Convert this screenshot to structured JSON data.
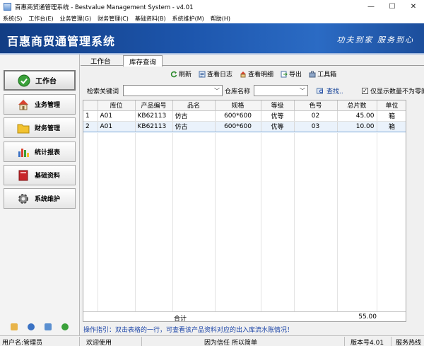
{
  "window": {
    "title": "百惠商贸通管理系统 - Bestvalue Management System - v4.01",
    "controls": [
      "—",
      "☐",
      "✕"
    ]
  },
  "menu": [
    "系统(S)",
    "工作台(E)",
    "业务管理(G)",
    "财务管理(C)",
    "基础资料(B)",
    "系统维护(M)",
    "帮助(H)"
  ],
  "banner": {
    "title": "百惠商贸通管理系统",
    "slogan": "功夫到家 服务到心"
  },
  "sidebar": {
    "items": [
      {
        "label": "工作台",
        "icon": "check-circle-icon",
        "active": true
      },
      {
        "label": "业务管理",
        "icon": "house-icon",
        "active": false
      },
      {
        "label": "财务管理",
        "icon": "folder-icon",
        "active": false
      },
      {
        "label": "统计报表",
        "icon": "bar-chart-icon",
        "active": false
      },
      {
        "label": "基础资料",
        "icon": "book-icon",
        "active": false
      },
      {
        "label": "系统维护",
        "icon": "gear-icon",
        "active": false
      }
    ],
    "footer_icons": [
      "edit-icon",
      "info-icon",
      "search-icon",
      "refresh-icon"
    ]
  },
  "tabs": [
    {
      "label": "工作台",
      "active": false
    },
    {
      "label": "库存查询",
      "active": true
    }
  ],
  "toolbar": {
    "refresh": "刷新",
    "view_log": "查看日志",
    "view_detail": "查看明细",
    "export": "导出",
    "toolbox": "工具箱"
  },
  "filters": {
    "keyword_label": "检索关键词",
    "keyword_value": "",
    "warehouse_label": "仓库名称",
    "warehouse_value": "",
    "find_label": "查找..",
    "nonzero_label": "仅显示数量不为零的",
    "nonzero_checked": true
  },
  "grid": {
    "columns": [
      "",
      "库位",
      "产品编号",
      "品名",
      "规格",
      "等级",
      "色号",
      "总片数",
      "单位"
    ],
    "rows": [
      [
        "1",
        "A01",
        "KB62113",
        "仿古",
        "600*600",
        "优等",
        "02",
        "45.00",
        "箱"
      ],
      [
        "2",
        "A01",
        "KB62113",
        "仿古",
        "600*600",
        "优等",
        "03",
        "10.00",
        "箱"
      ]
    ],
    "selected_row": 1,
    "total_label": "合计",
    "total_value": "55.00"
  },
  "hint": "操作指引：双击表格的一行，可查看该产品资料对应的出入库流水账情况！",
  "status": {
    "user": "用户名:管理员",
    "mode": "欢迎使用",
    "motto": "因为信任 所以简单",
    "version": "版本号4.01",
    "service": "服务热线"
  },
  "colors": {
    "banner": "#1d56ad",
    "accent_link": "#1c45a8",
    "selection": "#eaf2fb"
  }
}
